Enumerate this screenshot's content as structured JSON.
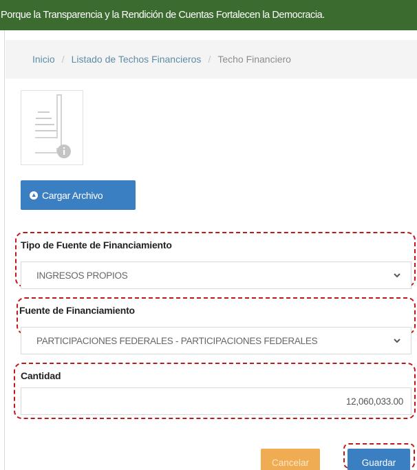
{
  "banner": {
    "text": "Porque la Transparencia y la Rendición de Cuentas Fortalecen la Democracia."
  },
  "breadcrumb": {
    "items": [
      "Inicio",
      "Listado de Techos Financieros",
      "Techo Financiero"
    ],
    "separator": "/"
  },
  "file": {
    "icon": "document-info-icon"
  },
  "upload_button": {
    "label": "Cargar Archivo",
    "icon": "circle-arrow-up-icon"
  },
  "form": {
    "tipo_fuente": {
      "label": "Tipo de Fuente de Financiamiento",
      "value": "INGRESOS PROPIOS"
    },
    "fuente": {
      "label": "Fuente de Financiamiento",
      "value": "PARTICIPACIONES FEDERALES - PARTICIPACIONES FEDERALES"
    },
    "cantidad": {
      "label": "Cantidad",
      "value": "12,060,033.00"
    }
  },
  "actions": {
    "cancel_label": "Cancelar",
    "save_label": "Guardar"
  },
  "colors": {
    "banner": "#3c6b2f",
    "primary": "#3b7fc3",
    "warning": "#efac52",
    "highlight": "#c01818",
    "link": "#5e8ba6"
  }
}
